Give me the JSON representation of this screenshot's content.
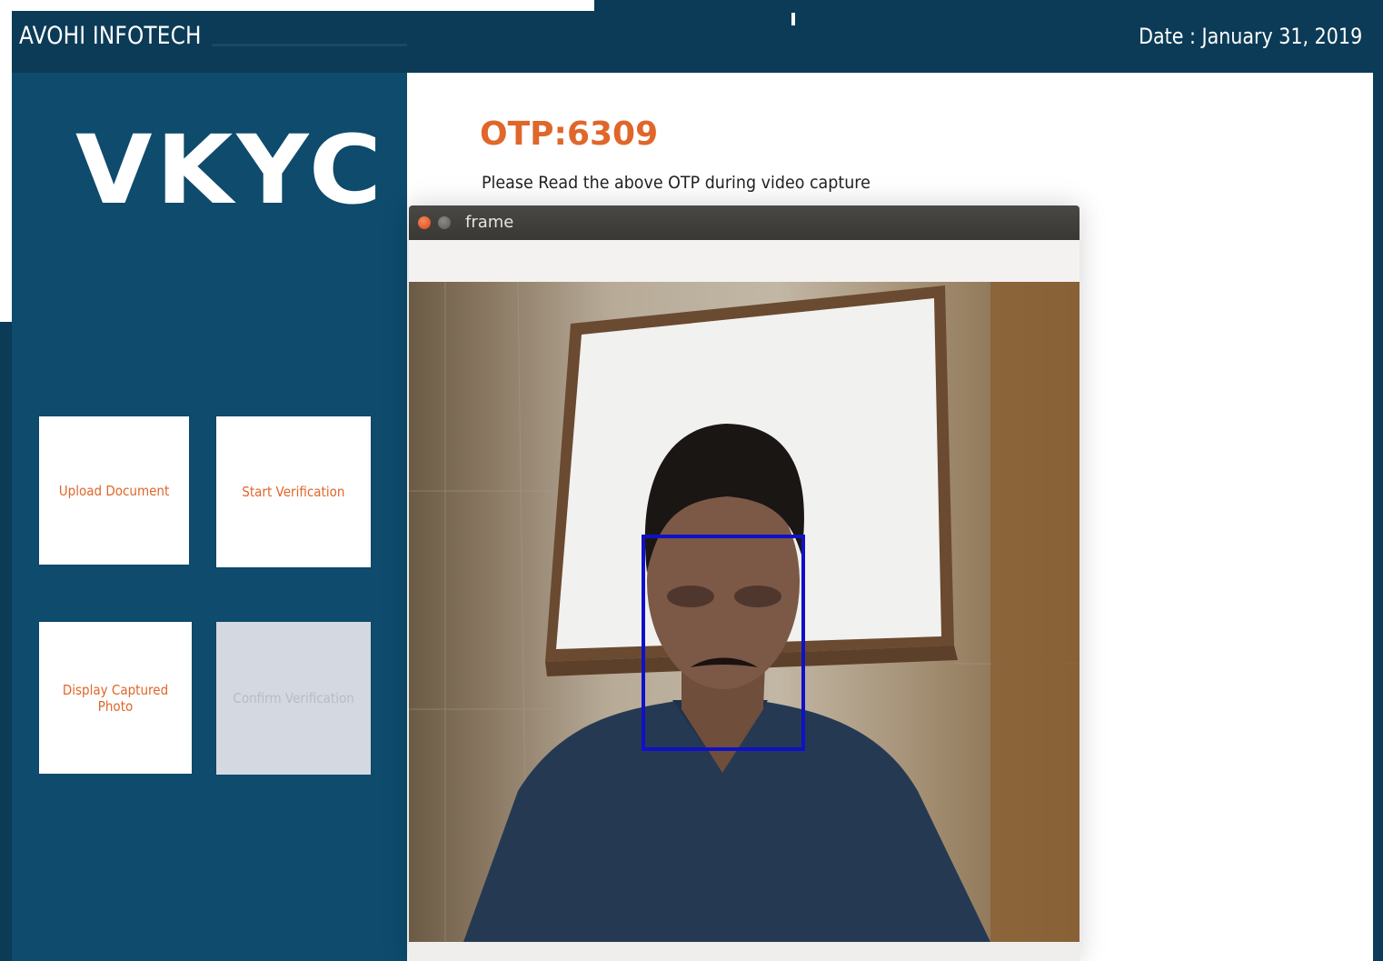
{
  "header": {
    "brand": "AVOHI INFOTECH",
    "date": "Date : January 31, 2019"
  },
  "sidebar": {
    "logo_text": "VKYC",
    "tiles": [
      {
        "label": "Upload Document",
        "enabled": true
      },
      {
        "label": "Start Verification",
        "enabled": true
      },
      {
        "label": "Display Captured Photo",
        "enabled": true
      },
      {
        "label": "Confirm Verification",
        "enabled": false
      }
    ]
  },
  "main": {
    "otp": "OTP:6309",
    "otp_hint": "Please Read the above OTP during video capture"
  },
  "video_window": {
    "title": "frame",
    "face_box_color": "#1010c8"
  },
  "colors": {
    "header_bg": "#0b3b56",
    "sidebar_bg": "#0e4b6d",
    "accent": "#e0662a",
    "content_bg": "#ffffff"
  }
}
